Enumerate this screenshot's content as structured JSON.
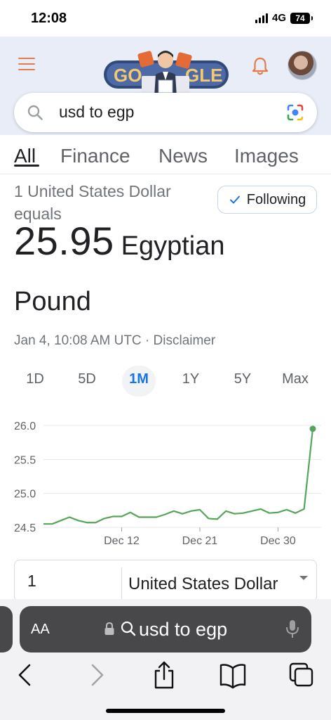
{
  "status": {
    "time": "12:08",
    "network": "4G",
    "battery": "74"
  },
  "search": {
    "query": "usd to egp"
  },
  "tabs": [
    {
      "label": "All",
      "active": true
    },
    {
      "label": "Finance",
      "active": false
    },
    {
      "label": "News",
      "active": false
    },
    {
      "label": "Images",
      "active": false
    }
  ],
  "conversion": {
    "subtitle": "1 United States Dollar equals",
    "value": "25.95",
    "currency_line1": "Egyptian",
    "currency_line2": "Pound",
    "timestamp": "Jan 4, 10:08 AM UTC · Disclaimer",
    "follow_label": "Following"
  },
  "ranges": [
    {
      "label": "1D",
      "active": false
    },
    {
      "label": "5D",
      "active": false
    },
    {
      "label": "1M",
      "active": true
    },
    {
      "label": "1Y",
      "active": false
    },
    {
      "label": "5Y",
      "active": false
    },
    {
      "label": "Max",
      "active": false
    }
  ],
  "chart_data": {
    "type": "line",
    "y_ticks": [
      "26.0",
      "25.5",
      "25.0",
      "24.5"
    ],
    "x_ticks": [
      "Dec 12",
      "Dec 21",
      "Dec 30"
    ],
    "ylim": [
      24.5,
      26.0
    ],
    "grid": true,
    "line_color": "#57a55a",
    "series": [
      {
        "values": [
          24.55,
          24.55,
          24.6,
          24.65,
          24.6,
          24.57,
          24.57,
          24.63,
          24.66,
          24.66,
          24.72,
          24.65,
          24.65,
          24.65,
          24.69,
          24.74,
          24.7,
          24.74,
          24.76,
          24.63,
          24.62,
          24.74,
          24.7,
          24.71,
          24.74,
          24.77,
          24.71,
          24.72,
          24.76,
          24.71,
          24.77,
          25.95
        ]
      }
    ]
  },
  "converter": {
    "amount": "1",
    "currency": "United States Dollar"
  },
  "safari": {
    "text_size_label": "AA",
    "address": "usd to egp"
  },
  "colors": {
    "accent_blue": "#1a73e8",
    "header_bg": "#e8edf7",
    "chart_line": "#57a55a"
  }
}
